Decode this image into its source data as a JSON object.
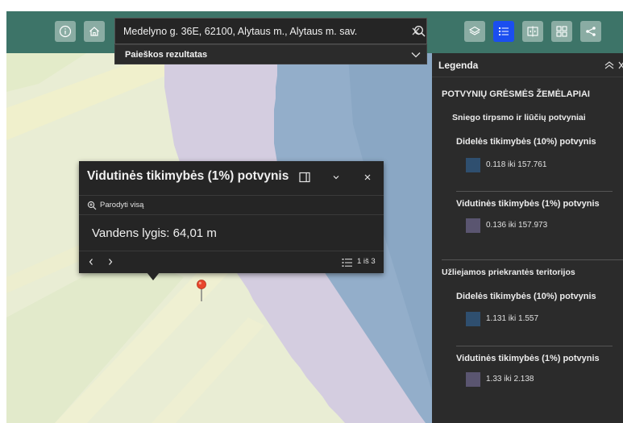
{
  "header": {
    "search": {
      "value": "Medelyno g. 36E, 62100, Alytaus m., Alytaus m. sav.",
      "placeholder": ""
    },
    "results_label": "Paieškos rezultatas"
  },
  "legend": {
    "title": "Legenda",
    "layer_title": "POTVYNIŲ GRĖSMĖS ŽEMĖLAPIAI",
    "groups": [
      {
        "name": "Sniego tirpsmo ir liūčių potvyniai",
        "items": [
          {
            "label": "Didelės tikimybės (10%) potvynis",
            "range": "0.118 iki 157.761",
            "color": "#2f4f6f"
          },
          {
            "label": "Vidutinės tikimybės (1%) potvynis",
            "range": "0.136 iki 157.973",
            "color": "#5a5570"
          }
        ]
      },
      {
        "name": "Užliejamos priekrantės teritorijos",
        "items": [
          {
            "label": "Didelės tikimybės (10%) potvynis",
            "range": "1.131 iki 1.557",
            "color": "#2f4f6f"
          },
          {
            "label": "Vidutinės tikimybės (1%) potvynis",
            "range": "1.33 iki 2.138",
            "color": "#5a5570"
          }
        ]
      }
    ]
  },
  "popup": {
    "title": "Vidutinės tikimybės (1%) potvynis",
    "zoom_label": "Parodyti visą",
    "content": "Vandens lygis: 64,01 m",
    "count": "1 iš 3"
  },
  "colors": {
    "header": "#3d7468",
    "header_button": "#8aaca3",
    "active_button": "#1b4ef0",
    "panel_bg": "#2b2b2b",
    "flood_high": "#2f4f6f",
    "flood_medium": "#5a5570"
  },
  "icons": {
    "info": "info-icon",
    "home": "home-icon",
    "layers": "layers-icon",
    "legend": "legend-list-icon",
    "swipe": "swipe-compare-icon",
    "basemap": "basemap-gallery-icon",
    "share": "share-icon"
  }
}
